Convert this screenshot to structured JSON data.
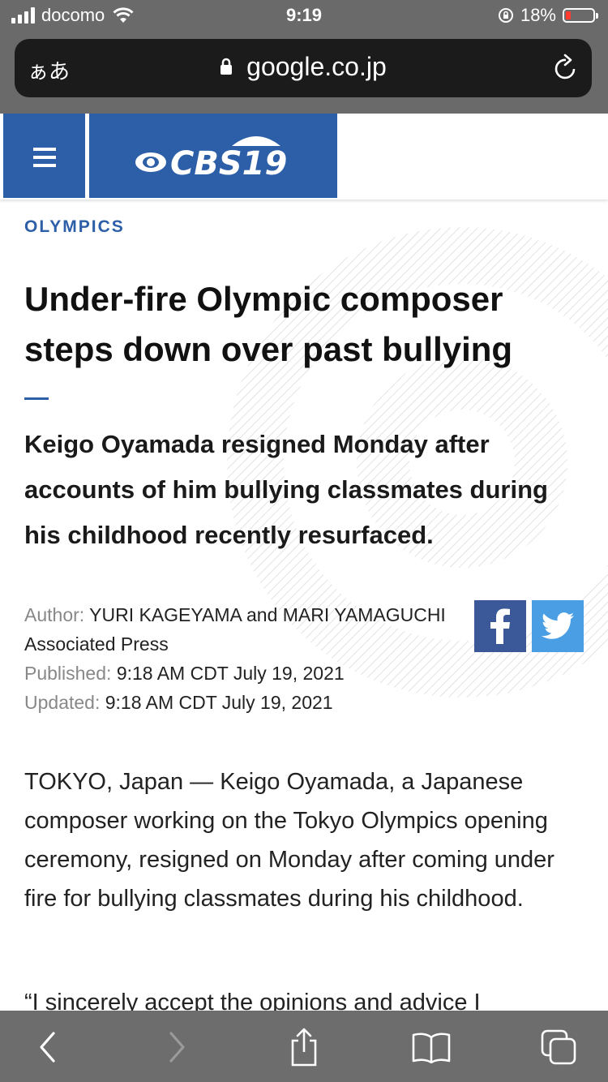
{
  "status_bar": {
    "carrier": "docomo",
    "time": "9:19",
    "battery": "18%",
    "battery_level": 0.18
  },
  "browser": {
    "text_size_button": "ぁあ",
    "url": "google.co.jp"
  },
  "site": {
    "logo_text": "CBS19"
  },
  "article": {
    "section": "OLYMPICS",
    "headline": "Under-fire Olympic composer steps down over past bullying",
    "dek": "Keigo Oyamada resigned Monday after accounts of him bullying classmates during his childhood recently resurfaced.",
    "author_label": "Author:",
    "author_value": "YURI KAGEYAMA and MARI YAMAGUCHI Associated Press",
    "published_label": "Published:",
    "published_value": "9:18 AM CDT July 19, 2021",
    "updated_label": "Updated:",
    "updated_value": "9:18 AM CDT July 19, 2021",
    "paragraph_1": "TOKYO, Japan — Keigo Oyamada, a Japanese composer working on the Tokyo Olympics opening ceremony, resigned on Monday after coming under fire for bullying classmates during his childhood.",
    "paragraph_2": "“I sincerely accept the opinions and advice I"
  },
  "share": {
    "facebook_icon": "facebook-icon",
    "twitter_icon": "twitter-icon"
  },
  "colors": {
    "brand_blue": "#2d5fa8",
    "facebook": "#3b5998",
    "twitter": "#4a9fe4"
  }
}
